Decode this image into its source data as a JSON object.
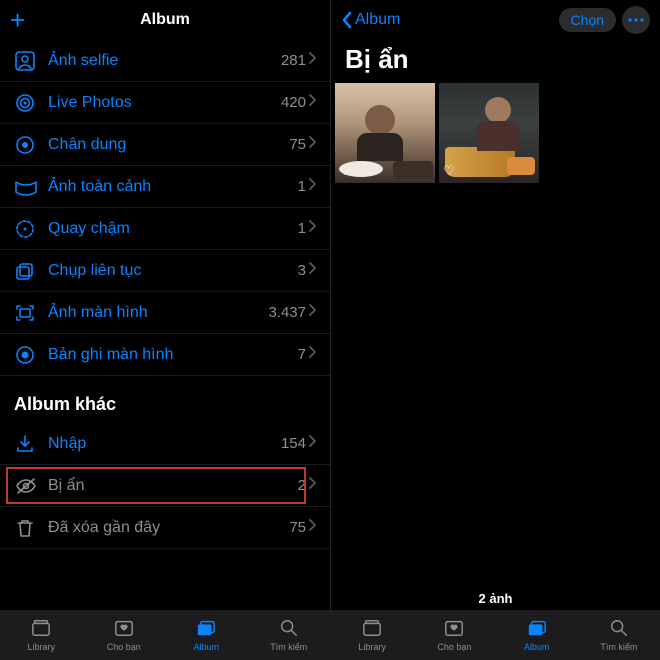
{
  "left": {
    "header_title": "Album",
    "rows": [
      {
        "icon": "person-square",
        "label": "Ảnh selfie",
        "count": "281"
      },
      {
        "icon": "live",
        "label": "Live Photos",
        "count": "420"
      },
      {
        "icon": "portrait",
        "label": "Chân dung",
        "count": "75"
      },
      {
        "icon": "pano",
        "label": "Ảnh toàn cảnh",
        "count": "1"
      },
      {
        "icon": "slomo",
        "label": "Quay chậm",
        "count": "1"
      },
      {
        "icon": "burst",
        "label": "Chụp liên tục",
        "count": "3"
      },
      {
        "icon": "screenshot",
        "label": "Ảnh màn hình",
        "count": "3.437"
      },
      {
        "icon": "record",
        "label": "Bản ghi màn hình",
        "count": "7"
      }
    ],
    "section_other": "Album khác",
    "rows2": [
      {
        "icon": "import",
        "label": "Nhập",
        "count": "154",
        "grey": false
      },
      {
        "icon": "hidden",
        "label": "Bị ẩn",
        "count": "2",
        "grey": true,
        "highlight": true
      },
      {
        "icon": "trash",
        "label": "Đã xóa gần đây",
        "count": "75",
        "grey": true
      }
    ]
  },
  "right": {
    "back_label": "Album",
    "select_label": "Chọn",
    "title": "Bị ẩn",
    "photo_count": "2 ảnh"
  },
  "tabs": [
    {
      "icon": "library",
      "label": "Library"
    },
    {
      "icon": "foryou",
      "label": "Cho bạn"
    },
    {
      "icon": "albums",
      "label": "Album"
    },
    {
      "icon": "search",
      "label": "Tìm kiếm"
    }
  ],
  "active_tab_index": 2
}
